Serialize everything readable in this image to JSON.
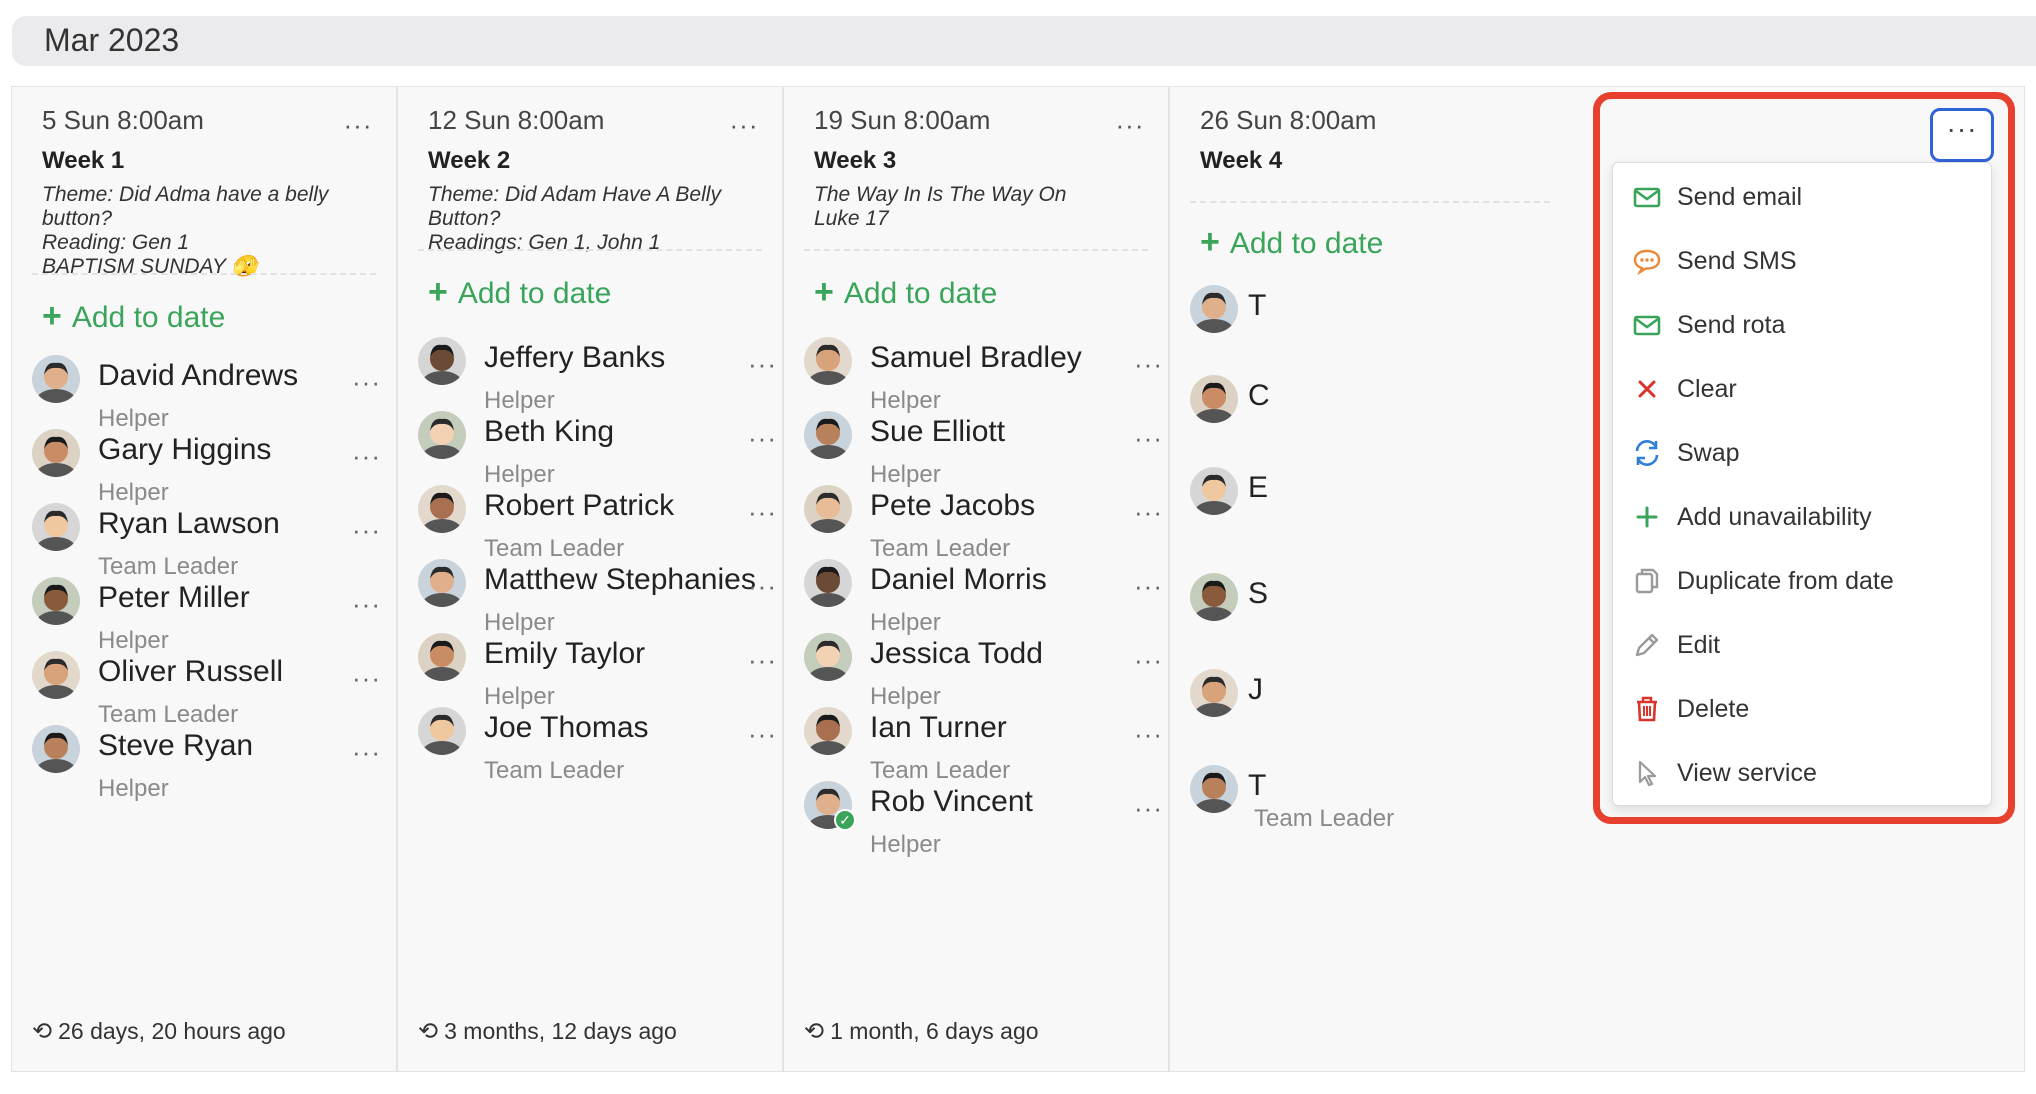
{
  "header": {
    "month": "Mar 2023"
  },
  "columns": [
    {
      "date": "5 Sun 8:00am",
      "week": "Week 1",
      "theme": "Theme: Did Adma have a belly button?\nReading: Gen 1\nBAPTISM SUNDAY 🫣",
      "add_label": "Add to date",
      "people": [
        {
          "name": "David Andrews",
          "role": "Helper"
        },
        {
          "name": "Gary Higgins",
          "role": "Helper"
        },
        {
          "name": "Ryan Lawson",
          "role": "Team Leader"
        },
        {
          "name": "Peter Miller",
          "role": "Helper"
        },
        {
          "name": "Oliver Russell",
          "role": "Team Leader"
        },
        {
          "name": "Steve Ryan",
          "role": "Helper"
        }
      ],
      "footer": "26 days, 20 hours ago"
    },
    {
      "date": "12 Sun 8:00am",
      "week": "Week 2",
      "theme": "Theme: Did Adam Have A Belly Button?\nReadings: Gen 1, John 1",
      "add_label": "Add to date",
      "people": [
        {
          "name": "Jeffery Banks",
          "role": "Helper"
        },
        {
          "name": "Beth King",
          "role": "Helper"
        },
        {
          "name": "Robert Patrick",
          "role": "Team Leader"
        },
        {
          "name": "Matthew Stephanies",
          "role": "Helper"
        },
        {
          "name": "Emily Taylor",
          "role": "Helper"
        },
        {
          "name": "Joe Thomas",
          "role": "Team Leader"
        }
      ],
      "footer": "3 months, 12 days ago"
    },
    {
      "date": "19 Sun 8:00am",
      "week": "Week 3",
      "theme": "The Way In Is The Way On\nLuke 17",
      "add_label": "Add to date",
      "people": [
        {
          "name": "Samuel Bradley",
          "role": "Helper"
        },
        {
          "name": "Sue Elliott",
          "role": "Helper"
        },
        {
          "name": "Pete Jacobs",
          "role": "Team Leader"
        },
        {
          "name": "Daniel Morris",
          "role": "Helper"
        },
        {
          "name": "Jessica Todd",
          "role": "Helper"
        },
        {
          "name": "Ian Turner",
          "role": "Team Leader"
        },
        {
          "name": "Rob Vincent",
          "role": "Helper"
        }
      ],
      "footer": "1 month, 6 days ago"
    },
    {
      "date": "26 Sun 8:00am",
      "week": "Week 4",
      "add_label": "Add to date",
      "hidden_role": "Team Leader",
      "people_initials": [
        "T",
        "C",
        "E",
        "S",
        "J",
        "T"
      ]
    }
  ],
  "menu": {
    "items": [
      {
        "label": "Send email",
        "icon": "envelope-icon"
      },
      {
        "label": "Send SMS",
        "icon": "chat-bubble-icon"
      },
      {
        "label": "Send rota",
        "icon": "envelope-icon"
      },
      {
        "label": "Clear",
        "icon": "x-icon"
      },
      {
        "label": "Swap",
        "icon": "refresh-icon"
      },
      {
        "label": "Add unavailability",
        "icon": "plus-icon"
      },
      {
        "label": "Duplicate from date",
        "icon": "copy-icon"
      },
      {
        "label": "Edit",
        "icon": "pencil-icon"
      },
      {
        "label": "Delete",
        "icon": "trash-icon"
      },
      {
        "label": "View service",
        "icon": "cursor-icon"
      }
    ]
  },
  "ui": {
    "more_glyph": "···",
    "plus_glyph": "+",
    "history_glyph": "⟲",
    "check_glyph": "✓"
  },
  "colors": {
    "accent_green": "#3aa55a",
    "highlight_red": "#e8402f",
    "focus_blue": "#2f63d6",
    "sms_orange": "#e8883a",
    "clear_red": "#d9342b",
    "swap_blue": "#2f7ed8",
    "delete_red": "#d9342b",
    "muted_gray": "#9a9a9a"
  }
}
